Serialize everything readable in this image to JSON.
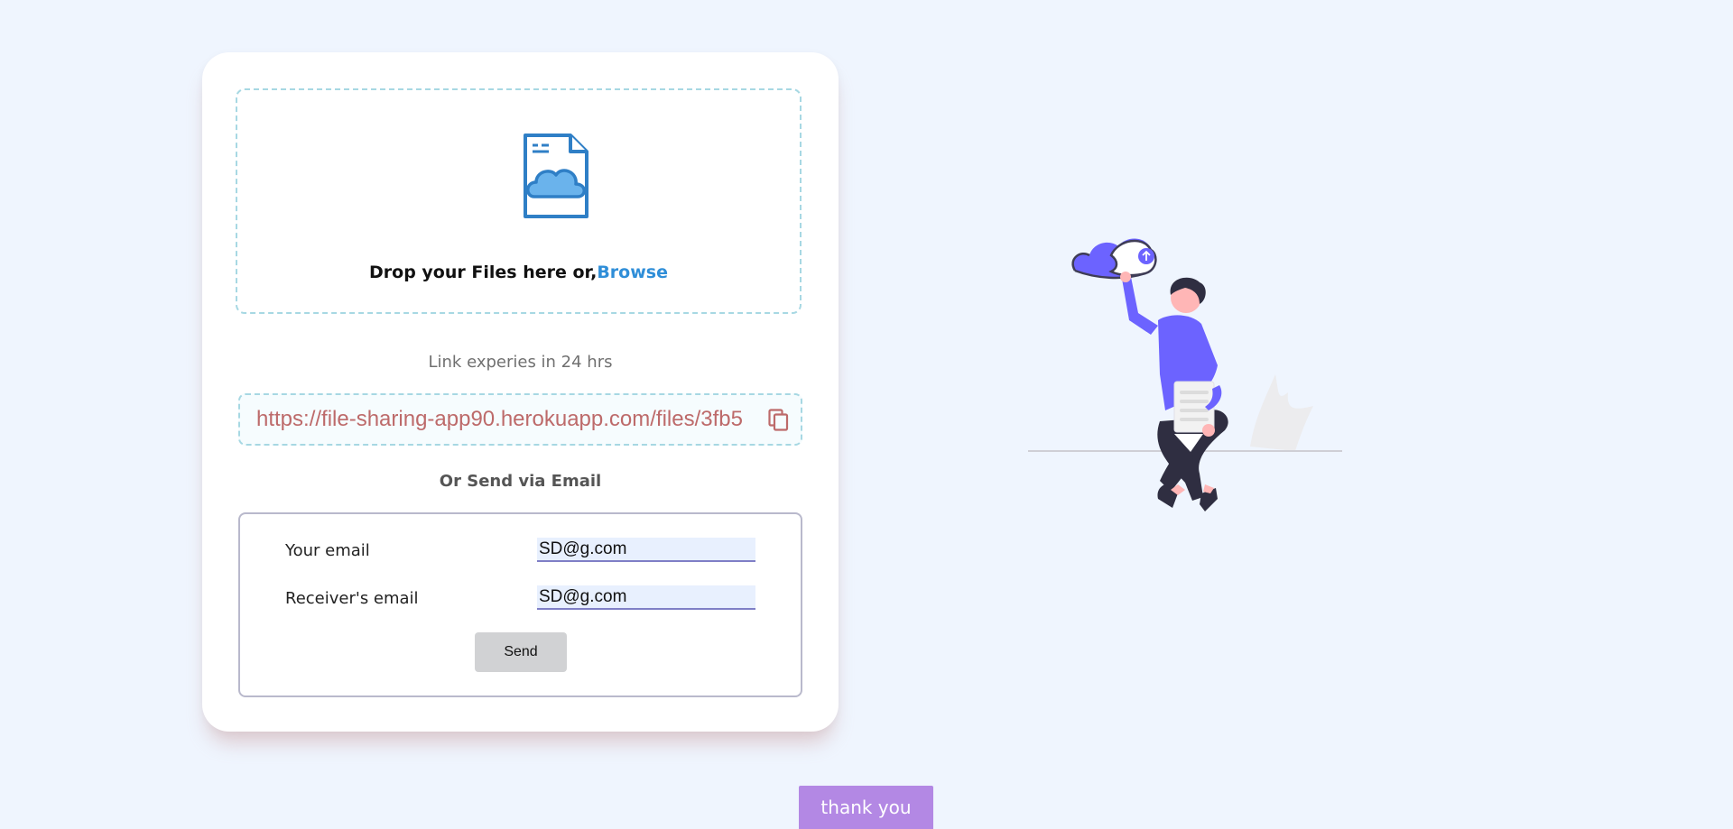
{
  "upload_card": {
    "drop_zone": {
      "instruction_text": "Drop your Files here or,",
      "browse_label": "Browse",
      "icon": "cloud-file-icon"
    },
    "expiry_text": "Link experies in 24 hrs",
    "share_link": {
      "url": "https://file-sharing-app90.herokuapp.com/files/3fb5",
      "copy_icon": "copy-icon"
    },
    "or_email_text": "Or Send via Email",
    "email_form": {
      "sender_label": "Your email",
      "sender_value": "SD@g.com",
      "receiver_label": "Receiver's email",
      "receiver_value": "SD@g.com",
      "send_label": "Send"
    }
  },
  "toast": {
    "text": "thank you"
  },
  "colors": {
    "background": "#eff5fe",
    "accent_blue": "#2f8ed8",
    "link_text": "#bd6a6a",
    "dashed_border": "#a7d8e3",
    "toast_bg": "#b388e4",
    "illustration_purple": "#6c63ff"
  }
}
